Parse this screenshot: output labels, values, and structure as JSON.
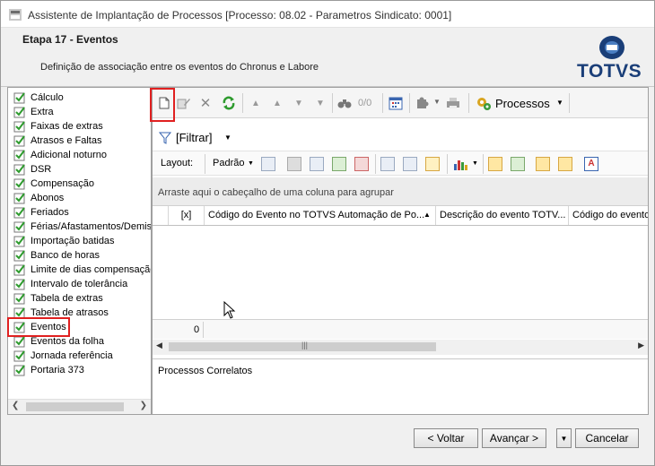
{
  "window": {
    "title": "Assistente de Implantação de Processos [Processo: 08.02 - Parametros Sindicato: 0001]"
  },
  "header": {
    "step": "Etapa 17 - Eventos",
    "description": "Definição de associação entre os eventos do Chronus e Labore",
    "logo_text": "TOTVS"
  },
  "sidebar": {
    "items": [
      {
        "label": "Cálculo"
      },
      {
        "label": "Extra"
      },
      {
        "label": "Faixas de extras"
      },
      {
        "label": "Atrasos e Faltas"
      },
      {
        "label": "Adicional noturno"
      },
      {
        "label": "DSR"
      },
      {
        "label": "Compensação"
      },
      {
        "label": "Abonos"
      },
      {
        "label": "Feriados"
      },
      {
        "label": "Férias/Afastamentos/Demis"
      },
      {
        "label": "Importação batidas"
      },
      {
        "label": "Banco de horas"
      },
      {
        "label": "Limite de dias compensação"
      },
      {
        "label": "Intervalo de tolerância"
      },
      {
        "label": "Tabela de extras"
      },
      {
        "label": "Tabela de atrasos"
      },
      {
        "label": "Eventos",
        "selected": true
      },
      {
        "label": "Eventos da folha"
      },
      {
        "label": "Jornada referência"
      },
      {
        "label": "Portaria 373"
      }
    ]
  },
  "toolbar": {
    "page_indicator": "0/0",
    "processes_label": "Processos"
  },
  "filter": {
    "label": "[Filtrar]"
  },
  "layout_toolbar": {
    "layout_label": "Layout:",
    "preset_label": "Padrão"
  },
  "grid": {
    "group_hint": "Arraste aqui o cabeçalho de uma coluna para agrupar",
    "columns": [
      {
        "label": "[x]"
      },
      {
        "label": "Código do Evento no TOTVS Automação de Po..."
      },
      {
        "label": "Descrição do evento TOTV..."
      },
      {
        "label": "Código do evento"
      }
    ],
    "footer_count": "0"
  },
  "related": {
    "label": "Processos Correlatos"
  },
  "buttons": {
    "back": "< Voltar",
    "next": "Avançar >",
    "cancel": "Cancelar"
  },
  "colors": {
    "highlight_red": "#e02020",
    "check_green": "#2e9b2e",
    "brand_blue": "#1a3e78"
  }
}
